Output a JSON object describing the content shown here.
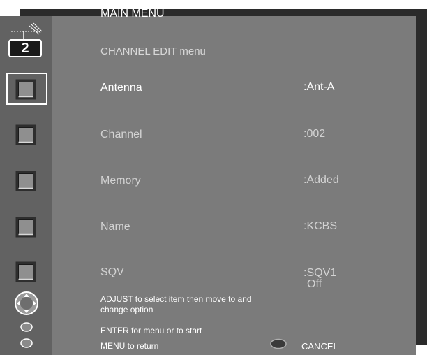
{
  "menu": {
    "title": "MAIN MENU",
    "channel_badge": "2",
    "subtitle": "CHANNEL EDIT menu"
  },
  "rows": [
    {
      "label": "Antenna",
      "value": ":Ant-A",
      "selected": true
    },
    {
      "label": "Channel",
      "value": ":002",
      "selected": false
    },
    {
      "label": "Memory",
      "value": ":Added",
      "selected": false
    },
    {
      "label": "Name",
      "value": ":KCBS",
      "selected": false
    },
    {
      "label": "SQV",
      "value": ":SQV1",
      "value_line2": "Off",
      "selected": false
    }
  ],
  "hints": {
    "adjust": "ADJUST to select item then move to and change option",
    "enter": "ENTER for menu or to start",
    "menu": "MENU to return",
    "cancel": "CANCEL"
  },
  "colors": {
    "selected_text": "#ffffff",
    "dim_text": "#d3d3d3",
    "background": "#7b7b7b",
    "sidebar": "#626262"
  },
  "icons": {
    "antenna": "antenna-icon",
    "row": "checkbox-square-icon",
    "adjust": "adjust-dial-icon",
    "enter": "enter-button-icon",
    "menu": "menu-button-icon",
    "cancel": "cancel-button-icon"
  }
}
